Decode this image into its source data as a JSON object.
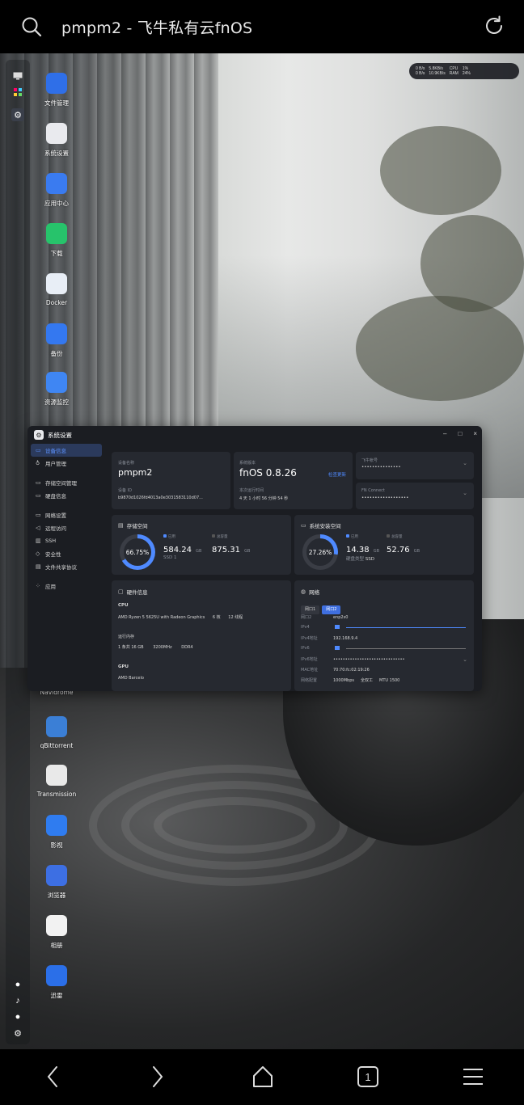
{
  "browser": {
    "url_title": "pmpm2 - 飞牛私有云fnOS",
    "tab_count": "1"
  },
  "monitor": {
    "up": "0 B/s",
    "down": "0 B/s",
    "net2_up": "5.8KB/s",
    "net2_down": "10.9KB/s",
    "cpu_label": "CPU",
    "cpu_val": "1%",
    "ram_label": "RAM",
    "ram_val": "24%"
  },
  "desktop_apps": [
    {
      "label": "文件管理",
      "icon": "folder-icon",
      "color": "#2f6fe8"
    },
    {
      "label": "系统设置",
      "icon": "gear-icon",
      "color": "#e9eaee"
    },
    {
      "label": "应用中心",
      "icon": "store-icon",
      "color": "#3a7bf0"
    },
    {
      "label": "下载",
      "icon": "download-icon",
      "color": "#27c36b"
    },
    {
      "label": "Docker",
      "icon": "docker-icon",
      "color": "#e8eef6"
    },
    {
      "label": "备份",
      "icon": "backup-icon",
      "color": "#3478f0"
    },
    {
      "label": "资源监控",
      "icon": "monitor-icon",
      "color": "#3f86f3"
    },
    {
      "label": "Navidrome",
      "icon": "music-icon",
      "color": "#2a2b30"
    },
    {
      "label": "qBittorrent",
      "icon": "qb-icon",
      "color": "#3b7fd6"
    },
    {
      "label": "Transmission",
      "icon": "transmission-icon",
      "color": "#e9e9e9"
    },
    {
      "label": "影视",
      "icon": "video-icon",
      "color": "#2f7cf0"
    },
    {
      "label": "浏览器",
      "icon": "browser-icon",
      "color": "#3d6fe3"
    },
    {
      "label": "相册",
      "icon": "photos-icon",
      "color": "#f2f2f2"
    },
    {
      "label": "迅雷",
      "icon": "thunder-icon",
      "color": "#2b6fe8"
    }
  ],
  "window": {
    "title": "系统设置",
    "nav": [
      {
        "label": "设备信息",
        "icon": "device-icon",
        "active": true
      },
      {
        "label": "用户管理",
        "icon": "users-icon"
      },
      {
        "label": "存储空间管理",
        "icon": "storage-icon"
      },
      {
        "label": "硬盘信息",
        "icon": "disk-icon"
      },
      {
        "label": "网络设置",
        "icon": "network-icon"
      },
      {
        "label": "远程访问",
        "icon": "remote-icon"
      },
      {
        "label": "SSH",
        "icon": "ssh-icon"
      },
      {
        "label": "安全性",
        "icon": "shield-icon"
      },
      {
        "label": "文件共享协议",
        "icon": "share-icon"
      },
      {
        "label": "应用",
        "icon": "apps-icon"
      }
    ],
    "device": {
      "name_label": "设备名称",
      "name": "pmpm2",
      "id_label": "设备 ID",
      "id": "b9870d1026fd4013a0e3031583110d07...",
      "version_label": "系统版本",
      "version": "fnOS 0.8.26",
      "check_update": "检查更新",
      "uptime_label": "本次运行时间",
      "uptime": "4 天 1 小时 56 分钟 54 秒",
      "account_label": "飞牛帐号",
      "account": "•••••••••••••••",
      "connect_label": "FN Connect",
      "connect": "••••••••••••••••••"
    },
    "storage": {
      "title": "存储空间",
      "percent": "66.75%",
      "percent_value": 66.75,
      "used_label": "已用",
      "used": "584.24",
      "total_label": "总容量",
      "total": "875.31",
      "unit": "GB",
      "ssd": "SSD 1"
    },
    "system_disk": {
      "title": "系统安装空间",
      "percent": "27.26%",
      "percent_value": 27.26,
      "used_label": "已用",
      "used": "14.38",
      "total_label": "总容量",
      "total": "52.76",
      "unit": "GB",
      "type_label": "硬盘类型",
      "type": "SSD"
    },
    "hardware": {
      "title": "硬件信息",
      "cpu_label": "CPU",
      "cpu": "AMD Ryzen 5 5625U with Radeon Graphics",
      "cores": "6 核",
      "threads": "12 线程",
      "mem_label": "运行内存",
      "mem": "1 条共 16 GB",
      "mem_speed": "3200MHz",
      "mem_type": "DDR4",
      "gpu_label": "GPU",
      "gpu": "AMD Barcelo"
    },
    "network": {
      "title": "网络",
      "tab1": "网口1",
      "tab2": "网口2",
      "port_label": "网口2",
      "port": "enp2s0",
      "ipv4_label": "IPv4",
      "ipv4_addr_label": "IPv4地址",
      "ipv4_addr": "192.168.9.4",
      "ipv6_label": "IPv6",
      "ipv6_addr_label": "IPv6地址",
      "ipv6_addr": "••••••••••••••••••••••••••••••",
      "mac_label": "MAC地址",
      "mac": "70:70:fc:02:19:26",
      "speed_label": "网络配置",
      "speed": "1000Mbps",
      "duplex": "全双工",
      "mtu": "MTU 1500"
    }
  }
}
